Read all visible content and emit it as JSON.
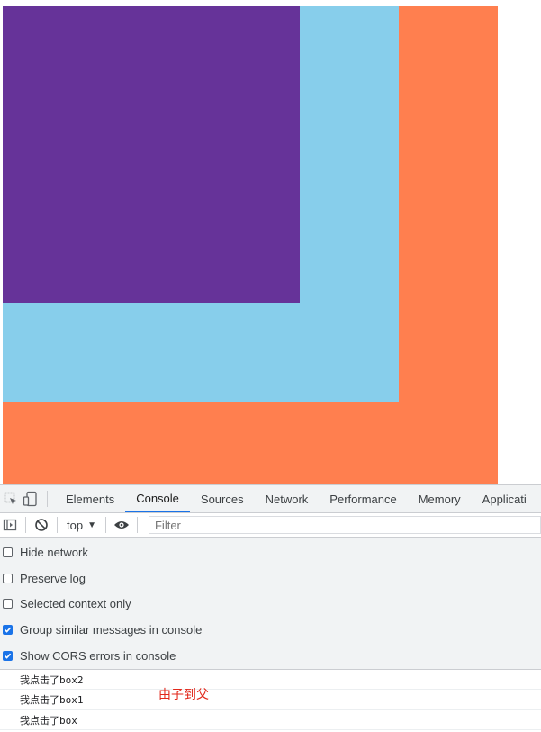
{
  "devtools": {
    "tabs": [
      "Elements",
      "Console",
      "Sources",
      "Network",
      "Performance",
      "Memory",
      "Applicati"
    ],
    "active_tab": "Console",
    "context_label": "top",
    "filter_placeholder": "Filter",
    "settings": [
      {
        "label": "Hide network",
        "checked": false
      },
      {
        "label": "Preserve log",
        "checked": false
      },
      {
        "label": "Selected context only",
        "checked": false
      },
      {
        "label": "Group similar messages in console",
        "checked": true
      },
      {
        "label": "Show CORS errors in console",
        "checked": true
      }
    ],
    "messages": [
      "我点击了box2",
      "我点击了box1",
      "我点击了box"
    ]
  },
  "annotation": "由子到父",
  "colors": {
    "box": "#ff7f4f",
    "box1": "#87ceeb",
    "box2": "#663399",
    "annotation": "#e2281b",
    "active_tab_underline": "#1a73e8"
  },
  "icons": [
    "inspect-element-icon",
    "device-toolbar-icon",
    "sidebar-toggle-icon",
    "clear-console-icon",
    "dropdown-arrow-icon",
    "eye-icon",
    "checkbox-check-icon"
  ]
}
